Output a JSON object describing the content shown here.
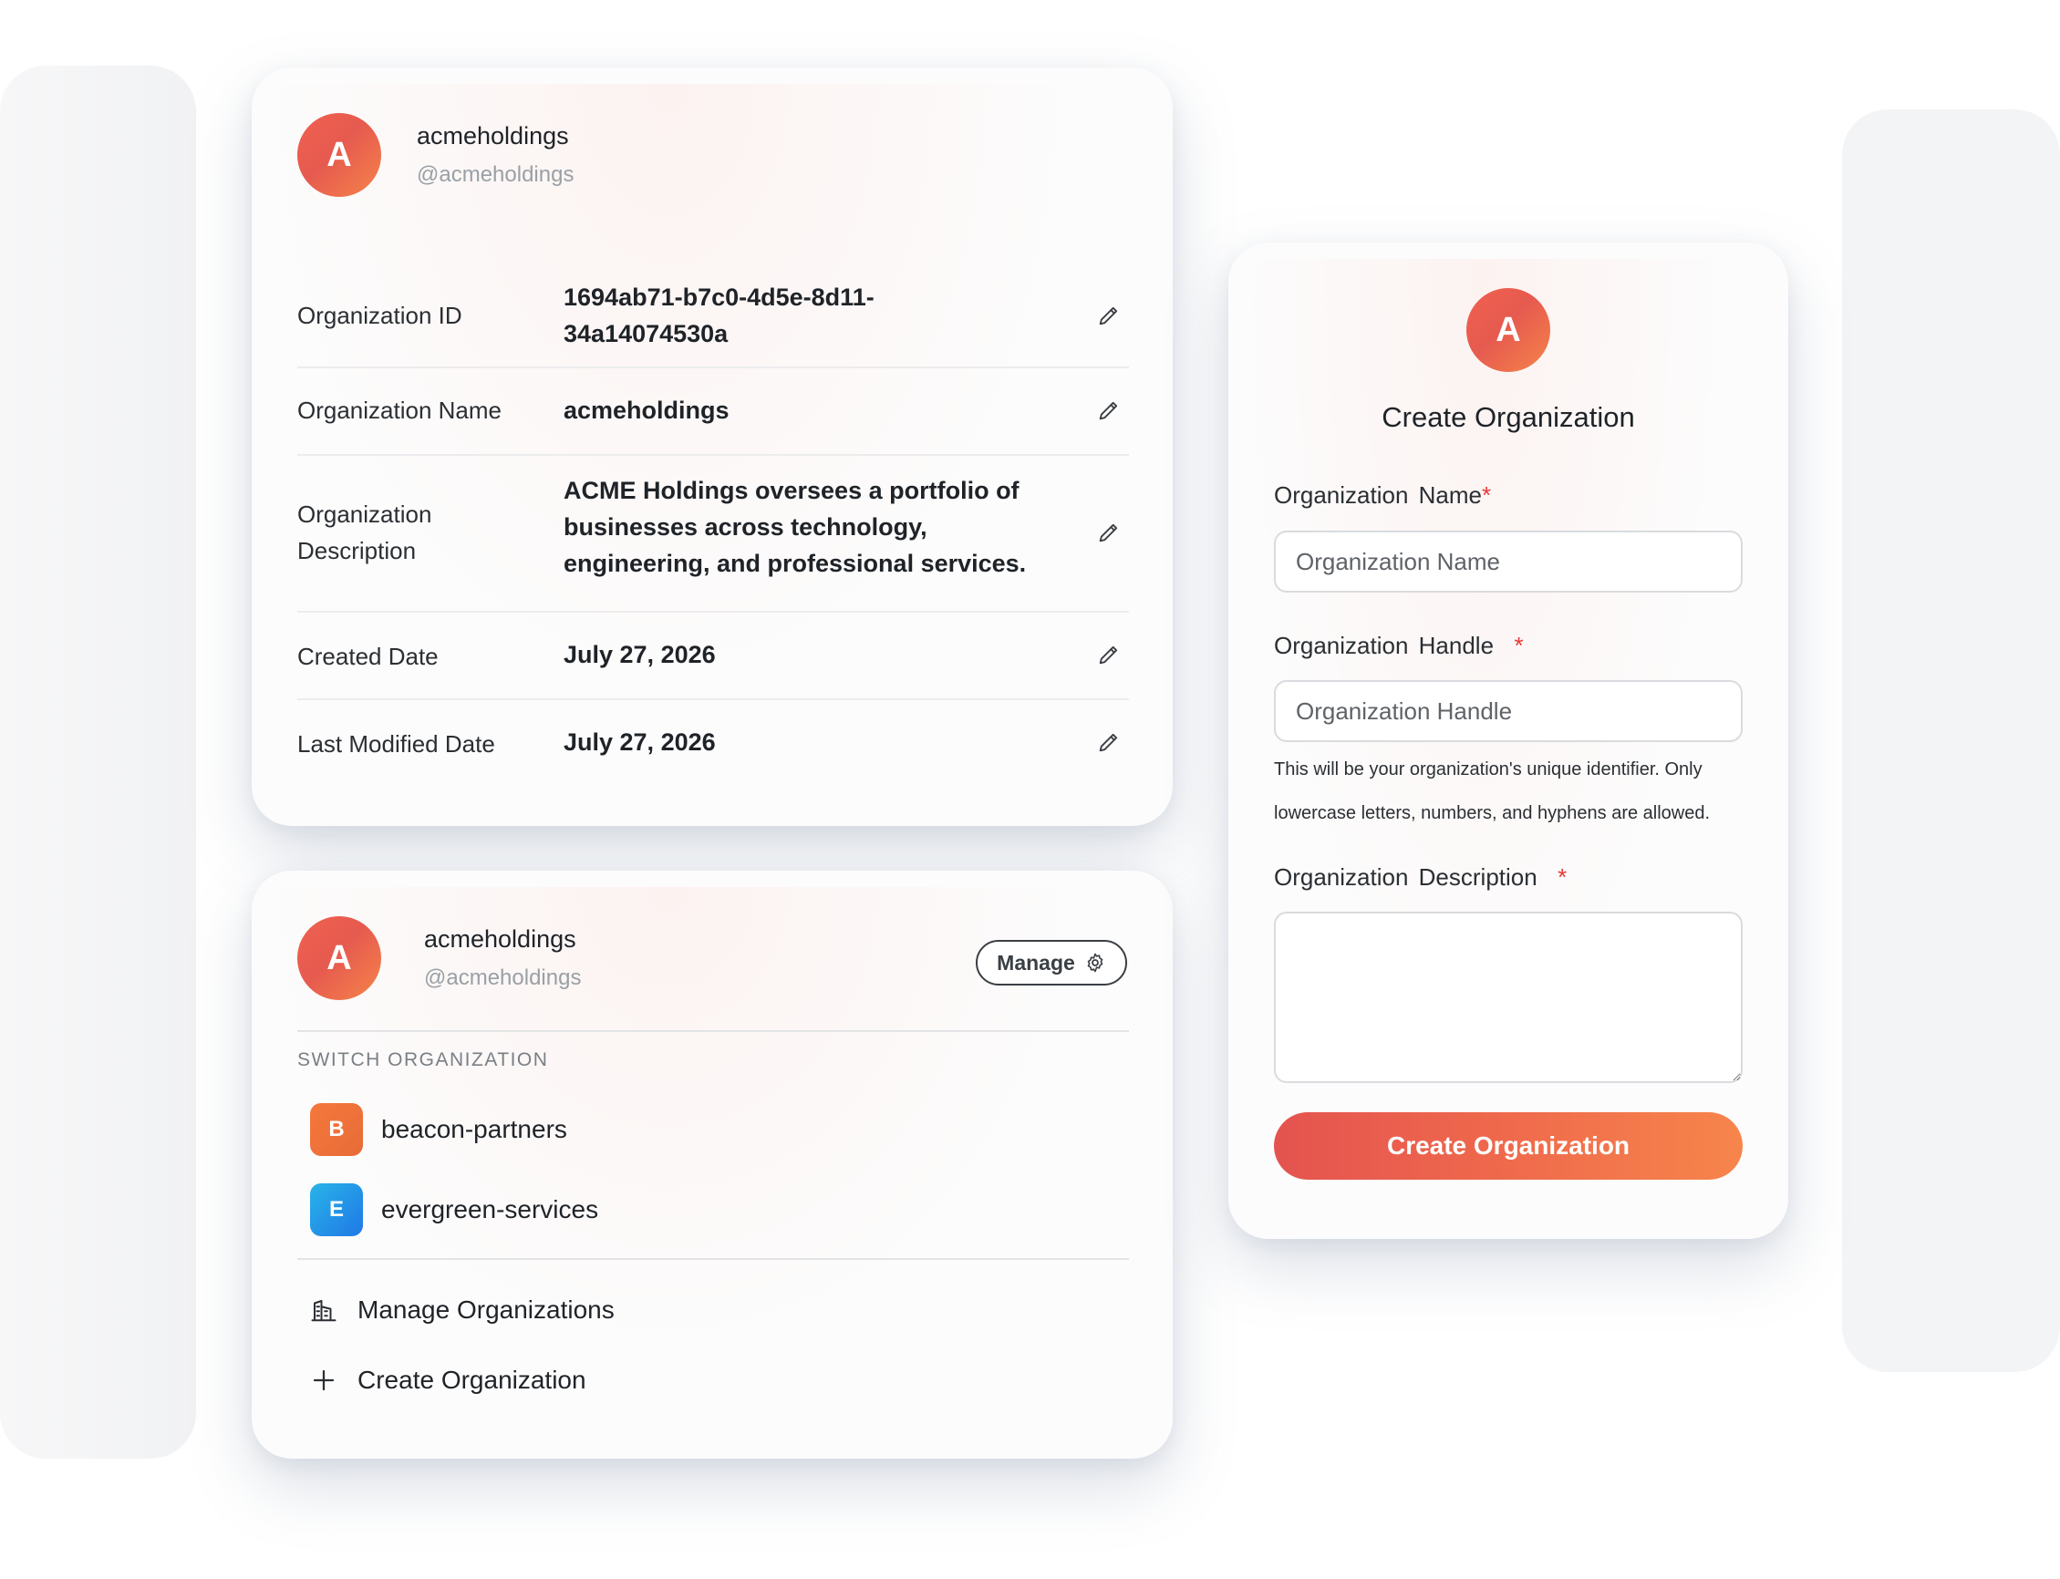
{
  "profile_card": {
    "avatar_letter": "A",
    "org_name": "acmeholdings",
    "org_handle": "@acmeholdings",
    "rows": [
      {
        "label": "Organization ID",
        "value": "1694ab71-b7c0-4d5e-8d11-34a14074530a"
      },
      {
        "label": "Organization Name",
        "value": "acmeholdings"
      },
      {
        "label": "Organization Description",
        "value": "ACME Holdings oversees a portfolio of businesses across technology, engineering, and professional services."
      },
      {
        "label": "Created Date",
        "value": "July 27, 2026"
      },
      {
        "label": "Last Modified Date",
        "value": "July 27, 2026"
      }
    ],
    "edit_icon": "pencil-icon"
  },
  "switcher_card": {
    "avatar_letter": "A",
    "org_name": "acmeholdings",
    "org_handle": "@acmeholdings",
    "manage_label": "Manage",
    "manage_icon": "gear-icon",
    "section_label": "SWITCH ORGANIZATION",
    "organizations": [
      {
        "letter": "B",
        "name": "beacon-partners",
        "color": "#f0733a"
      },
      {
        "letter": "E",
        "name": "evergreen-services",
        "color": "#2a8fe8"
      }
    ],
    "actions": [
      {
        "icon": "building-icon",
        "label": "Manage Organizations"
      },
      {
        "icon": "plus-icon",
        "label": "Create Organization"
      }
    ]
  },
  "create_form": {
    "avatar_letter": "A",
    "title": "Create Organization",
    "name_label": "Organization  Name",
    "name_placeholder": "Organization Name",
    "handle_label": "Organization  Handle",
    "handle_placeholder": "Organization Handle",
    "handle_help": "This will be your organization's unique identifier. Only lowercase letters, numbers, and hyphens are allowed.",
    "description_label": "Organization  Description",
    "required_mark": "*",
    "submit_label": "Create Organization"
  },
  "colors": {
    "accent_start": "#e4534f",
    "accent_end": "#f7854b",
    "required": "#e53935"
  }
}
